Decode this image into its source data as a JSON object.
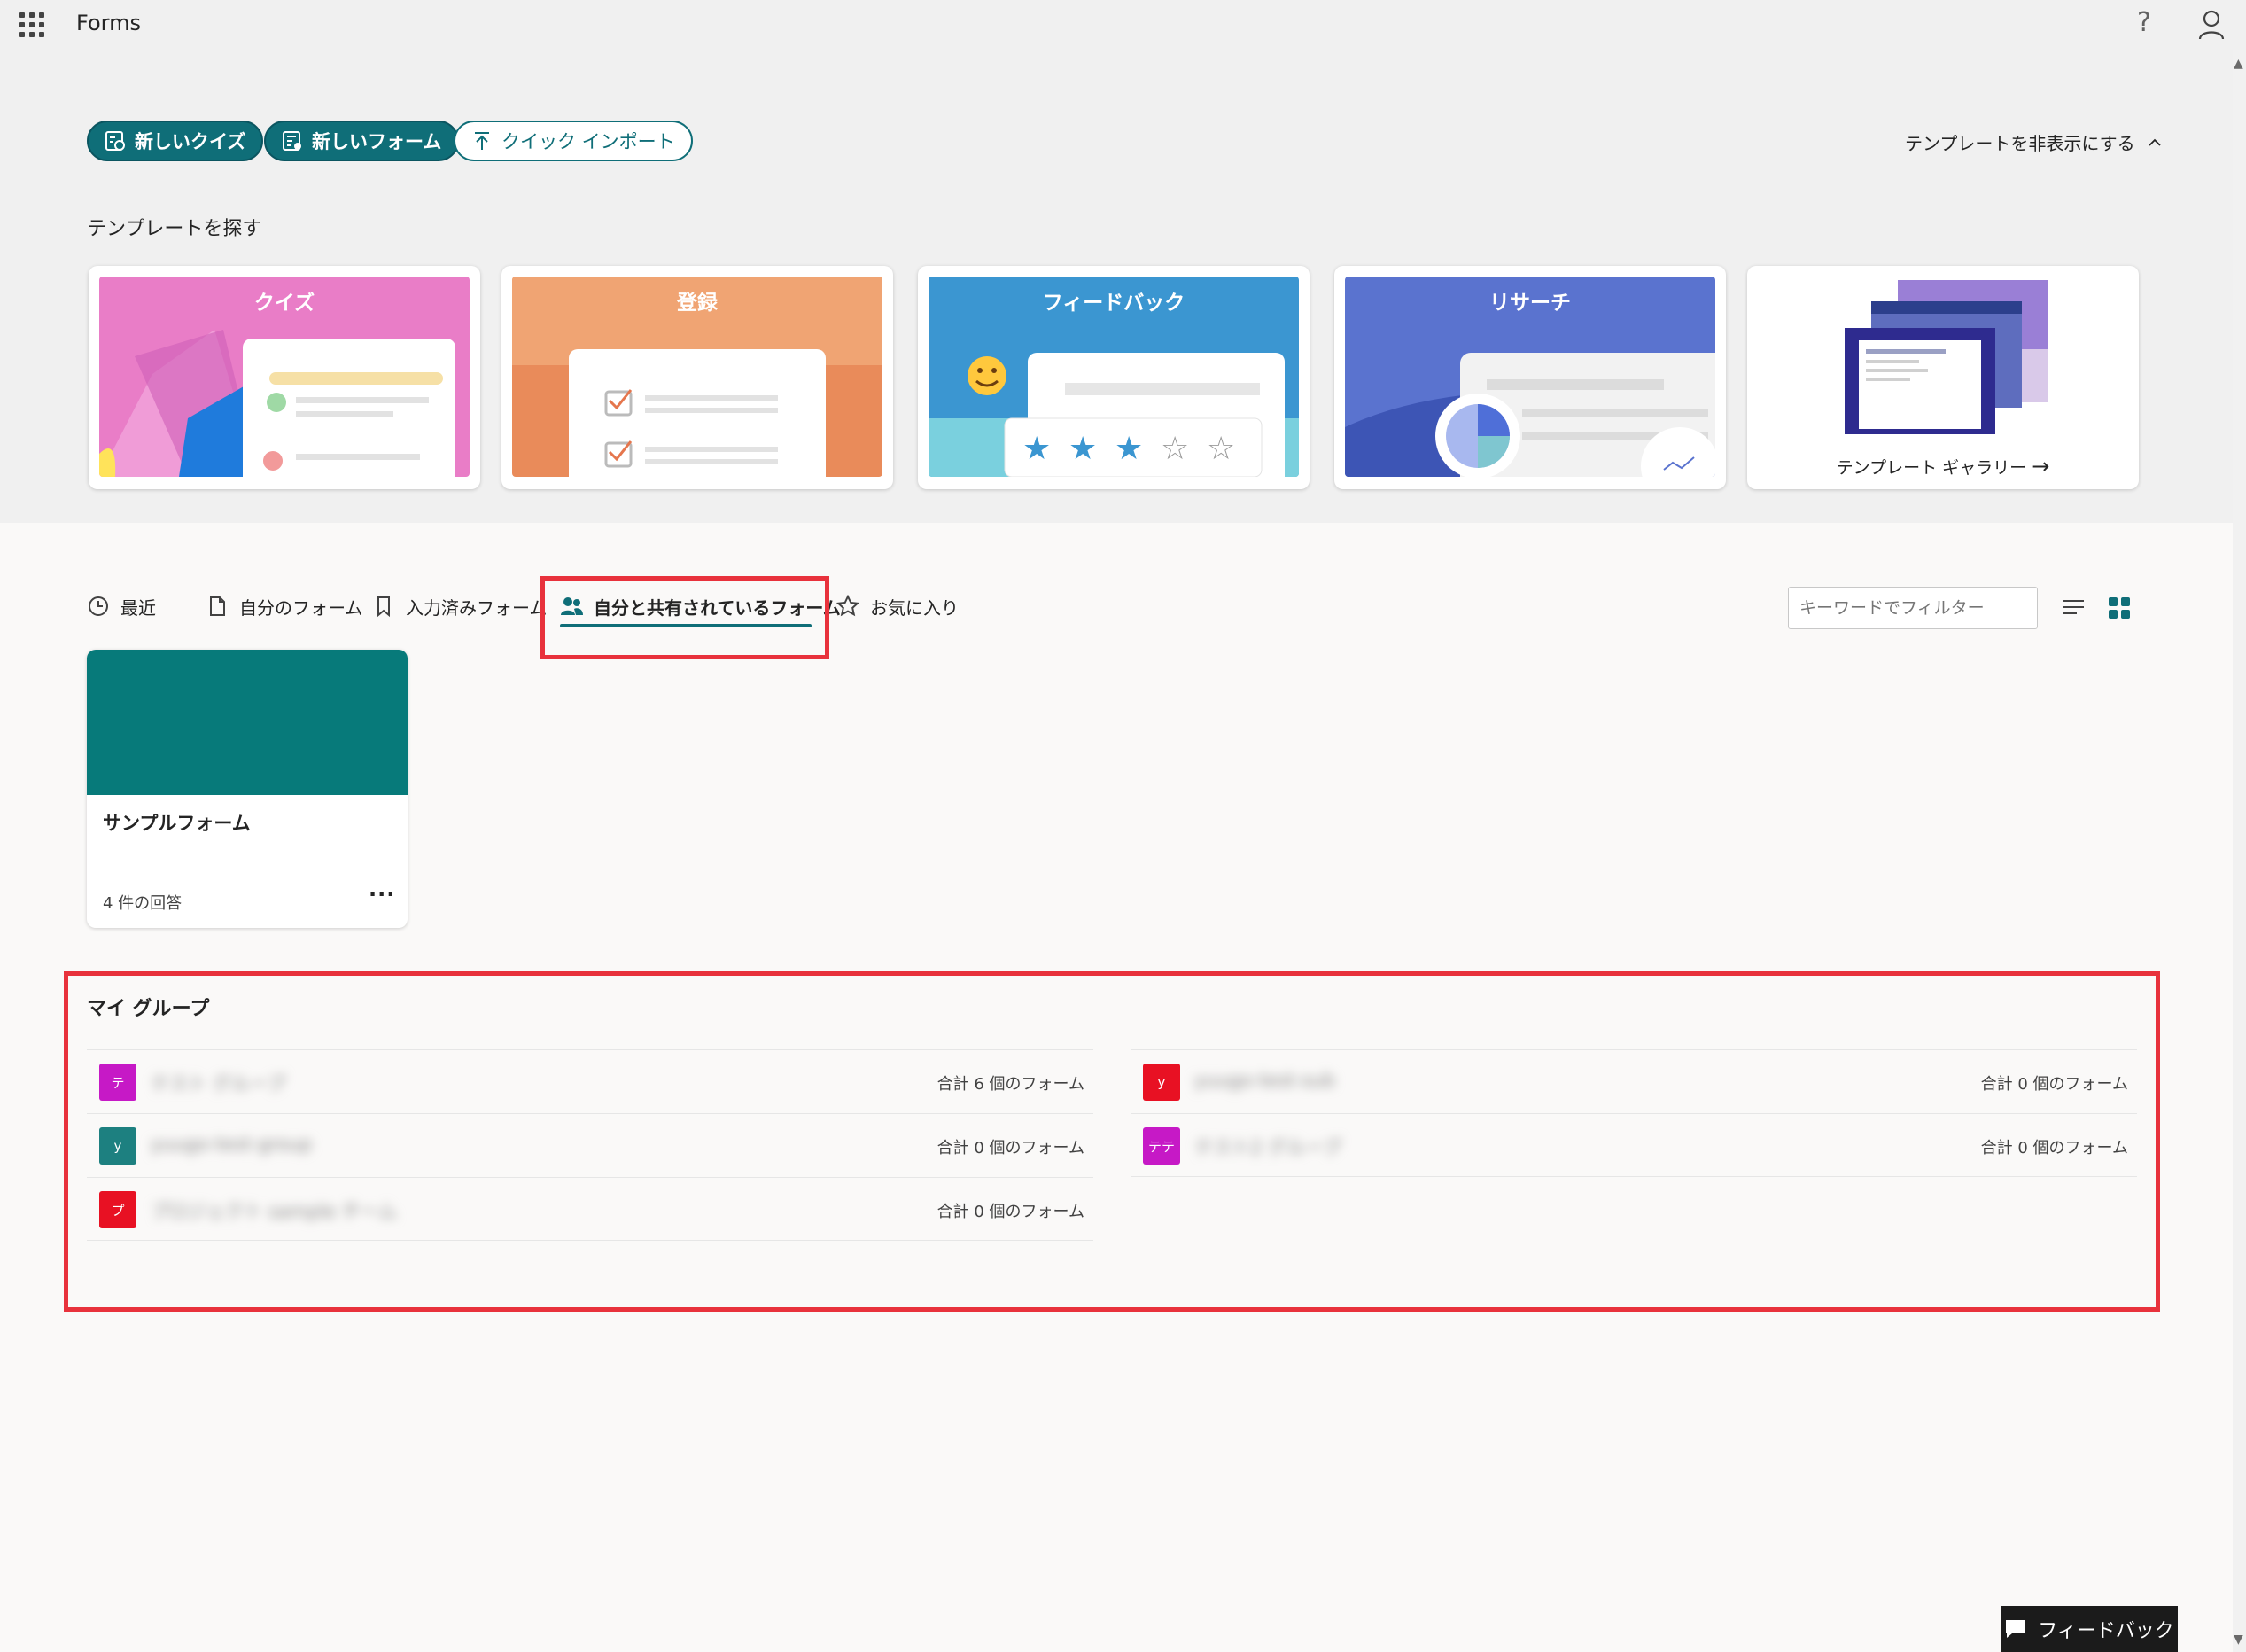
{
  "app": {
    "title": "Forms"
  },
  "header": {
    "new_quiz": "新しいクイズ",
    "new_form": "新しいフォーム",
    "quick_import": "クイック インポート",
    "hide_templates": "テンプレートを非表示にする",
    "explore_templates": "テンプレートを探す"
  },
  "templates": [
    {
      "label": "クイズ",
      "color": "#e47bc6"
    },
    {
      "label": "登録",
      "color": "#e98b5a"
    },
    {
      "label": "フィードバック",
      "color": "#3b96d1"
    },
    {
      "label": "リサーチ",
      "color": "#5a73cf"
    },
    {
      "label": "テンプレート ギャラリー"
    }
  ],
  "tabs": [
    {
      "label": "最近",
      "icon": "clock-icon"
    },
    {
      "label": "自分のフォーム",
      "icon": "document-icon"
    },
    {
      "label": "入力済みフォーム",
      "icon": "bookmark-icon"
    },
    {
      "label": "自分と共有されているフォーム",
      "icon": "people-icon",
      "active": true
    },
    {
      "label": "お気に入り",
      "icon": "star-icon"
    }
  ],
  "filter": {
    "placeholder": "キーワードでフィルター"
  },
  "forms": [
    {
      "name": "サンプルフォーム",
      "responses": "4 件の回答"
    }
  ],
  "groups": {
    "title": "マイ グループ",
    "left": [
      {
        "initial": "テ",
        "name": "テスト グループ",
        "count": "合計 6 個のフォーム",
        "color": "#c619c6"
      },
      {
        "initial": "y",
        "name": "yuugo-test-group",
        "count": "合計 0 個のフォーム",
        "color": "#1d8080"
      },
      {
        "initial": "プ",
        "name": "プロジェクト sample チーム",
        "count": "合計 0 個のフォーム",
        "color": "#e81123"
      }
    ],
    "right": [
      {
        "initial": "y",
        "name": "yuugo-test-sub",
        "count": "合計 0 個のフォーム",
        "color": "#e81123"
      },
      {
        "initial": "テテ",
        "name": "テスト2 グループ",
        "count": "合計 0 個のフォーム",
        "color": "#c619c6"
      }
    ]
  },
  "feedback_button": "フィードバック",
  "colors": {
    "accent": "#0f6e78",
    "highlight": "#e8323c"
  }
}
